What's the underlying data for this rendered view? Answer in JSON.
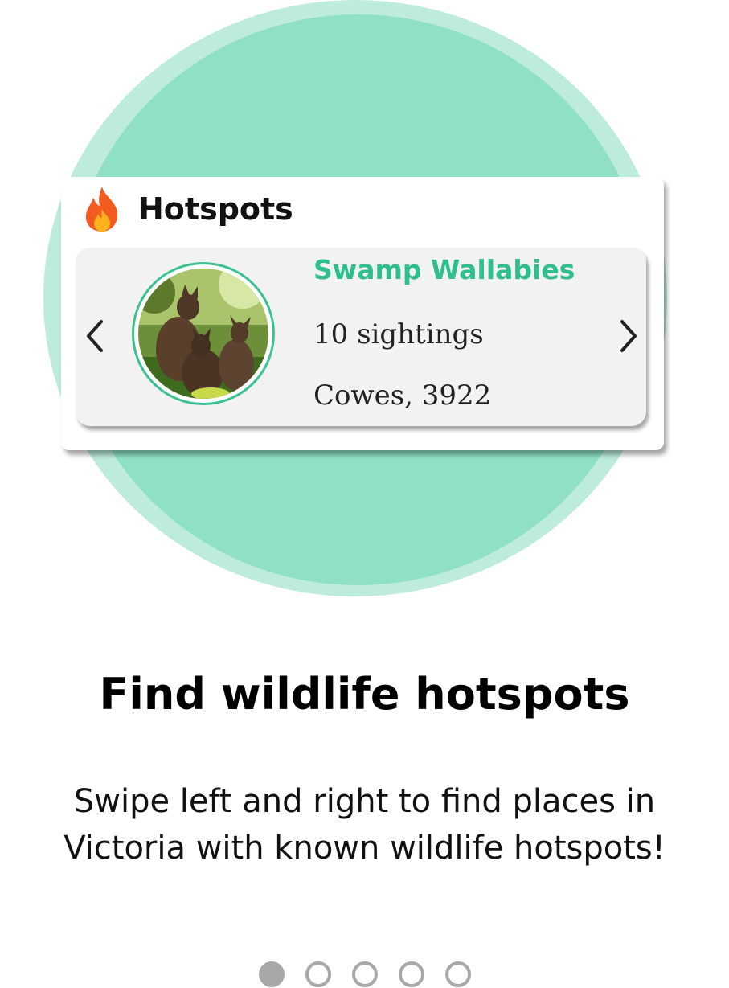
{
  "hotspots_card": {
    "title": "Hotspots",
    "header_icon": "fire-icon",
    "item": {
      "name": "Swamp Wallabies",
      "sightings": "10 sightings",
      "location": "Cowes, 3922"
    },
    "prev_icon": "chevron-left-icon",
    "next_icon": "chevron-right-icon"
  },
  "onboarding": {
    "headline": "Find wildlife hotspots",
    "description": "Swipe left and right to find places in Victoria with known wildlife hotspots!"
  },
  "pager": {
    "total_pages": 5,
    "current_page": 1
  },
  "colors": {
    "accent": "#2fbf8c",
    "circle_light": "#bdebdc",
    "circle_main": "#8fe0c7",
    "dot": "#a8a8a8"
  }
}
